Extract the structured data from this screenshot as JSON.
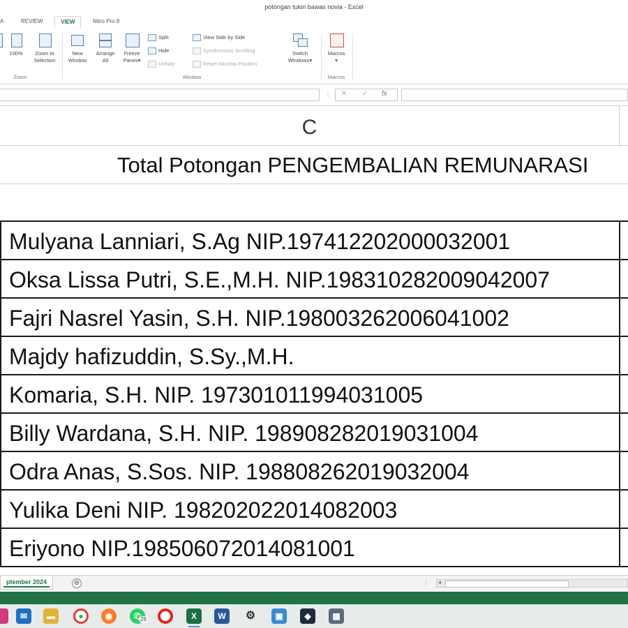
{
  "window": {
    "title": "potongan tukin bawas novia - Excel"
  },
  "ribbon": {
    "tabs": [
      "A",
      "REVIEW",
      "VIEW",
      "Nitro Pro 8"
    ],
    "active_tab": "VIEW",
    "buttons": {
      "zoom_100": "100%",
      "zoom_selection_1": "Zoom to",
      "zoom_selection_2": "Selection",
      "new_window_1": "New",
      "new_window_2": "Window",
      "arrange_all_1": "Arrange",
      "arrange_all_2": "All",
      "freeze_panes_1": "Freeze",
      "freeze_panes_2": "Panes",
      "split": "Split",
      "hide": "Hide",
      "unhide": "Unhide",
      "view_side_by_side": "View Side by Side",
      "sync_scrolling": "Synchronous Scrolling",
      "reset_window_position": "Reset Window Position",
      "switch_windows_1": "Switch",
      "switch_windows_2": "Windows",
      "macros": "Macros"
    },
    "groups": {
      "zoom": "Zoom",
      "window": "Window",
      "macros": "Macros"
    }
  },
  "formula_bar": {
    "cancel": "✕",
    "enter": "✓",
    "fx": "fx",
    "value": ""
  },
  "grid": {
    "column_header": "C",
    "title_cell": "Total Potongan PENGEMBALIAN REMUNARASI",
    "rows": [
      "Mulyana Lanniari, S.Ag NIP.197412202000032001",
      "Oksa Lissa Putri, S.E.,M.H. NIP.198310282009042007",
      "Fajri Nasrel Yasin, S.H. NIP.198003262006041002",
      "Majdy hafizuddin, S.Sy.,M.H.",
      "Komaria, S.H. NIP. 197301011994031005",
      "Billy Wardana, S.H. NIP. 198908282019031004",
      "Odra Anas, S.Sos. NIP. 198808262019032004",
      "Yulika Deni NIP. 198202022014082003",
      "Eriyono NIP.198506072014081001"
    ]
  },
  "sheets": {
    "active": "ptember 2024",
    "add": "⊕"
  },
  "taskbar": {
    "badge": "26"
  }
}
